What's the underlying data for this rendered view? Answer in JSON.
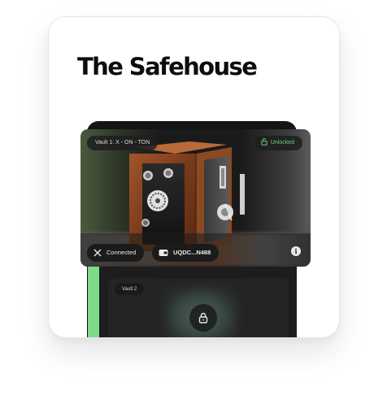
{
  "page": {
    "title": "The Safehouse"
  },
  "vault_main": {
    "label": "Vault 1: X - ON - TON",
    "status": "Unlocked",
    "social": {
      "label": "Connected",
      "icon": "x-logo-icon"
    },
    "wallet": {
      "label": "UQDC...N488",
      "icon": "wallet-icon"
    },
    "info_glyph": "i",
    "image": "safe-image"
  },
  "vault_second": {
    "label": "Vault 2",
    "locked_icon": "lock-icon"
  },
  "colors": {
    "accent_green": "#6fcf7a",
    "rail_green": "#7fd98a",
    "card_bg": "#ffffff",
    "dark": "#141414"
  }
}
